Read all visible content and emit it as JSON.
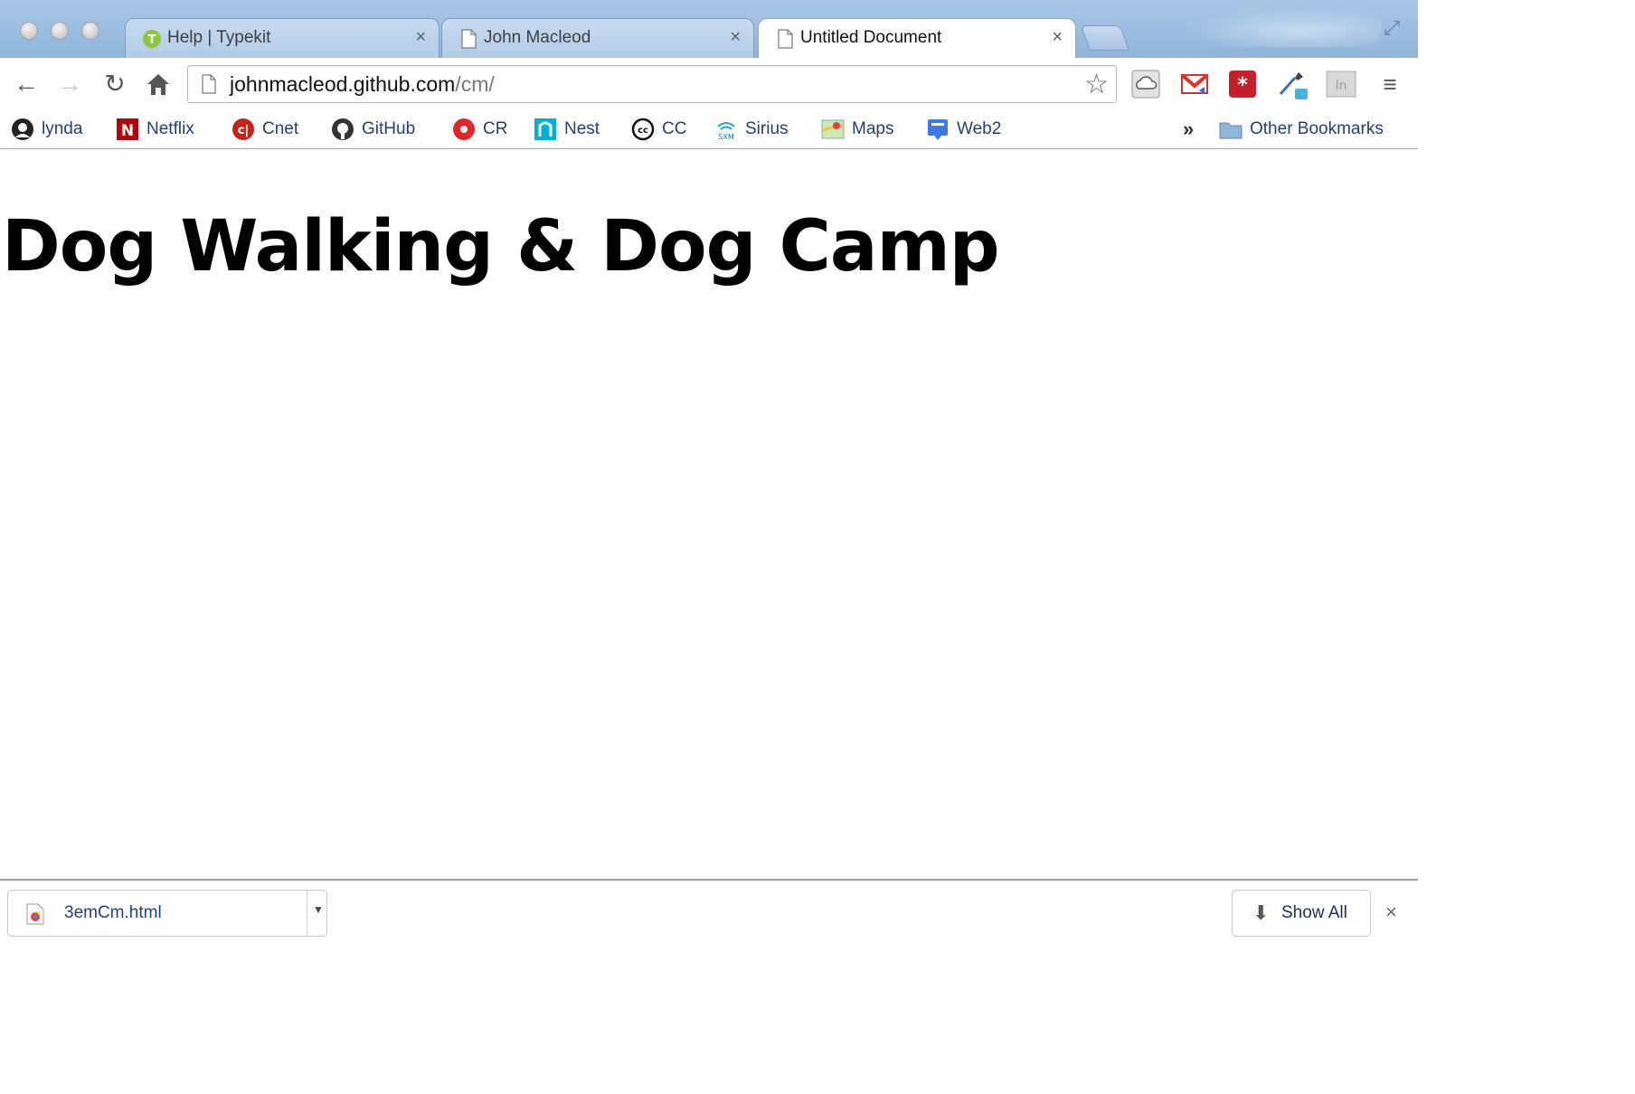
{
  "window": {
    "tabs": [
      {
        "label": "Help | Typekit",
        "icon": "typekit-icon",
        "active": false
      },
      {
        "label": "John Macleod",
        "icon": "page-icon",
        "active": false
      },
      {
        "label": "Untitled Document",
        "icon": "page-icon",
        "active": true
      }
    ],
    "tab_close_glyph": "×"
  },
  "toolbar": {
    "url_host": "johnmacleod.github.com",
    "url_path": "/cm/",
    "extensions": [
      "cloud-extension-icon",
      "gmail-icon",
      "lastpass-icon",
      "eyedropper-icon",
      "linkedin-icon"
    ]
  },
  "bookmarks": {
    "items": [
      {
        "label": "lynda",
        "icon": "lynda-icon"
      },
      {
        "label": "Netflix",
        "icon": "netflix-icon"
      },
      {
        "label": "Cnet",
        "icon": "cnet-icon"
      },
      {
        "label": "GitHub",
        "icon": "github-icon"
      },
      {
        "label": "CR",
        "icon": "cr-icon"
      },
      {
        "label": "Nest",
        "icon": "nest-icon"
      },
      {
        "label": "CC",
        "icon": "cc-icon"
      },
      {
        "label": "Sirius",
        "icon": "sirius-icon"
      },
      {
        "label": "Maps",
        "icon": "maps-icon"
      },
      {
        "label": "Web2",
        "icon": "web2-icon"
      }
    ],
    "overflow_glyph": "»",
    "other_label": "Other Bookmarks"
  },
  "page": {
    "heading": "Dog Walking & Dog Camp"
  },
  "downloads": {
    "file_name": "3emCm.html",
    "show_all_label": "Show All",
    "close_glyph": "×"
  },
  "colors": {
    "titlebar": "#8fb3d9",
    "bookmark_text": "#27406e",
    "heading": "#000000"
  }
}
